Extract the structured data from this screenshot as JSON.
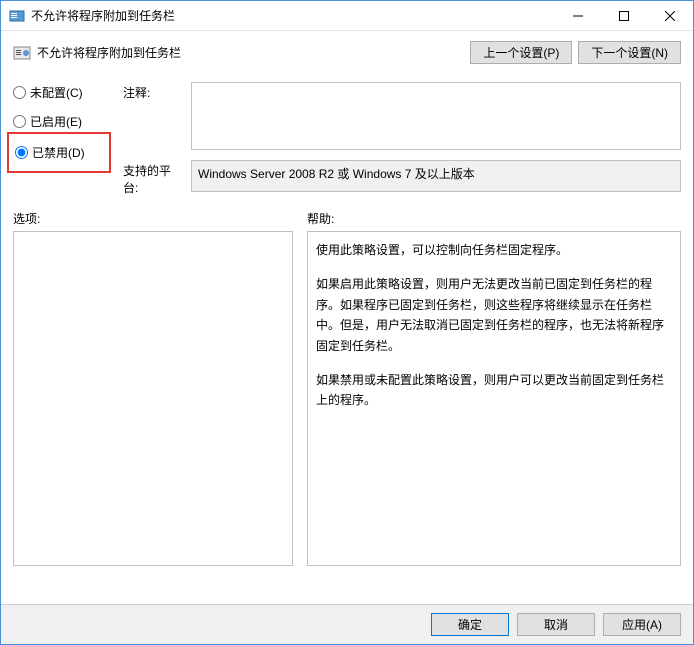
{
  "titlebar": {
    "title": "不允许将程序附加到任务栏"
  },
  "header": {
    "title": "不允许将程序附加到任务栏",
    "prev_btn": "上一个设置(P)",
    "next_btn": "下一个设置(N)"
  },
  "radios": {
    "not_configured": "未配置(C)",
    "enabled": "已启用(E)",
    "disabled": "已禁用(D)"
  },
  "fields": {
    "comment_label": "注释:",
    "comment_value": "",
    "platform_label": "支持的平台:",
    "platform_value": "Windows Server 2008 R2 或 Windows 7 及以上版本"
  },
  "panels": {
    "options_label": "选项:",
    "help_label": "帮助:",
    "help_paras": [
      "使用此策略设置，可以控制向任务栏固定程序。",
      "如果启用此策略设置，则用户无法更改当前已固定到任务栏的程序。如果程序已固定到任务栏，则这些程序将继续显示在任务栏中。但是，用户无法取消已固定到任务栏的程序，也无法将新程序固定到任务栏。",
      "如果禁用或未配置此策略设置，则用户可以更改当前固定到任务栏上的程序。"
    ]
  },
  "footer": {
    "ok": "确定",
    "cancel": "取消",
    "apply": "应用(A)"
  }
}
